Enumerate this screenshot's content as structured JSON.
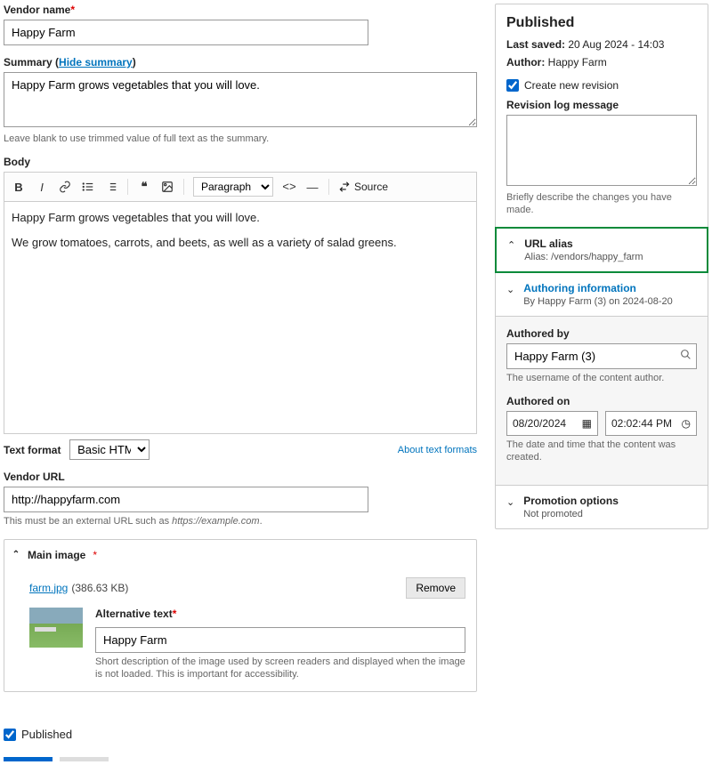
{
  "main": {
    "vendor_name": {
      "label": "Vendor name",
      "value": "Happy Farm"
    },
    "summary": {
      "label_prefix": "Summary (",
      "hide_link": "Hide summary",
      "label_suffix": ")",
      "value": "Happy Farm grows vegetables that you will love.",
      "help": "Leave blank to use trimmed value of full text as the summary."
    },
    "body": {
      "label": "Body",
      "paragraph1": "Happy Farm grows vegetables that you will love.",
      "paragraph2": "We grow tomatoes, carrots, and beets, as well as a variety of salad greens."
    },
    "toolbar": {
      "para_select": "Paragraph",
      "source": "Source"
    },
    "text_format": {
      "label": "Text format",
      "value": "Basic HTML",
      "about": "About text formats"
    },
    "vendor_url": {
      "label": "Vendor URL",
      "value": "http://happyfarm.com",
      "help_prefix": "This must be an external URL such as ",
      "help_example": "https://example.com"
    },
    "main_image": {
      "title": "Main image",
      "filename": "farm.jpg",
      "filesize": "(386.63 KB)",
      "remove": "Remove",
      "alt_label": "Alternative text",
      "alt_value": "Happy Farm",
      "alt_help": "Short description of the image used by screen readers and displayed when the image is not loaded. This is important for accessibility."
    },
    "published_label": "Published"
  },
  "side": {
    "status_title": "Published",
    "last_saved_label": "Last saved:",
    "last_saved_value": "20 Aug 2024 - 14:03",
    "author_label": "Author:",
    "author_value": "Happy Farm",
    "new_revision": "Create new revision",
    "revlog_label": "Revision log message",
    "revlog_help": "Briefly describe the changes you have made.",
    "url_alias": {
      "title": "URL alias",
      "sub": "Alias: /vendors/happy_farm"
    },
    "authoring": {
      "title": "Authoring information",
      "sub": "By Happy Farm (3) on 2024-08-20"
    },
    "authored_by": {
      "label": "Authored by",
      "value": "Happy Farm (3)",
      "help": "The username of the content author."
    },
    "authored_on": {
      "label": "Authored on",
      "date": "08/20/2024",
      "time": "02:02:44 PM",
      "help": "The date and time that the content was created."
    },
    "promotion": {
      "title": "Promotion options",
      "sub": "Not promoted"
    }
  }
}
